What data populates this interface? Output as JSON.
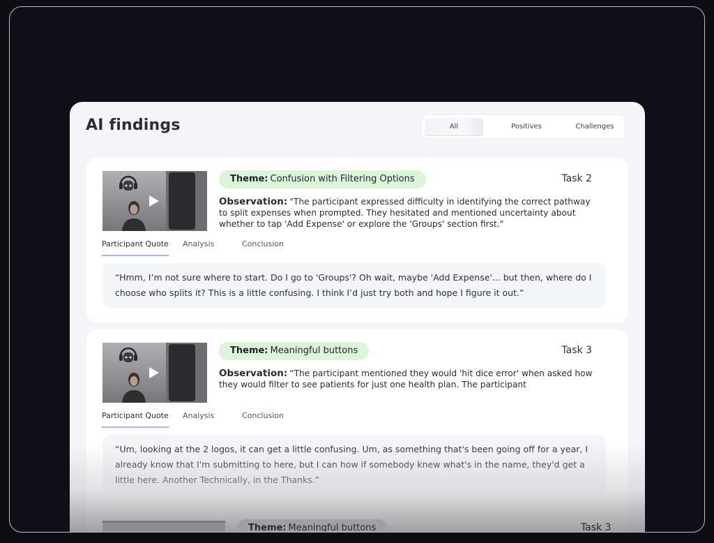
{
  "title": "AI findings",
  "filters": [
    "All",
    "Positives",
    "Challenges"
  ],
  "active_filter": "All",
  "cards": [
    {
      "theme_label": "Theme:",
      "theme": "Confusion with Filtering Options",
      "task": "Task 2",
      "observation_label": "Observation:",
      "observation": "\"The participant expressed difficulty in identifying the correct pathway to split expenses when prompted. They hesitated and mentioned uncertainty about whether to tap 'Add Expense' or explore the 'Groups' section first.\"",
      "tabs": [
        "Participant Quote",
        "Analysis",
        "Conclusion"
      ],
      "active_tab": "Participant Quote",
      "quote": "“Hmm, I’m not sure where to start. Do I go to 'Groups'? Oh wait, maybe 'Add Expense'... but then, where do I choose who splits it? This is a little confusing. I think I’d just try both and hope I figure it out.”"
    },
    {
      "theme_label": "Theme:",
      "theme": "Meaningful buttons",
      "task": "Task 3",
      "observation_label": "Observation:",
      "observation": "“The participant mentioned they would 'hit dice error' when asked how they would filter to see patients for just one health plan. The participant",
      "tabs": [
        "Participant Quote",
        "Analysis",
        "Conclusion"
      ],
      "active_tab": "Participant Quote",
      "quote": "“Um, looking at the 2 logos, it can get a little confusing. Um, as something that's been going off for a year, I already know that I'm submitting to here, but I can how if somebody knew what's in the name, they'd get a little here. Another Technically, in the Thanks.”"
    },
    {
      "theme_label": "Theme:",
      "theme": "Meaningful buttons",
      "task": "Task 3"
    }
  ],
  "colors": {
    "page_bg": "#0d0d14",
    "panel_bg": "#f4f5f9",
    "theme_pill": "#daf5d8",
    "tab_underline": "#a8b2ff"
  },
  "icons": [
    "play-icon",
    "robot-headphones-icon"
  ]
}
